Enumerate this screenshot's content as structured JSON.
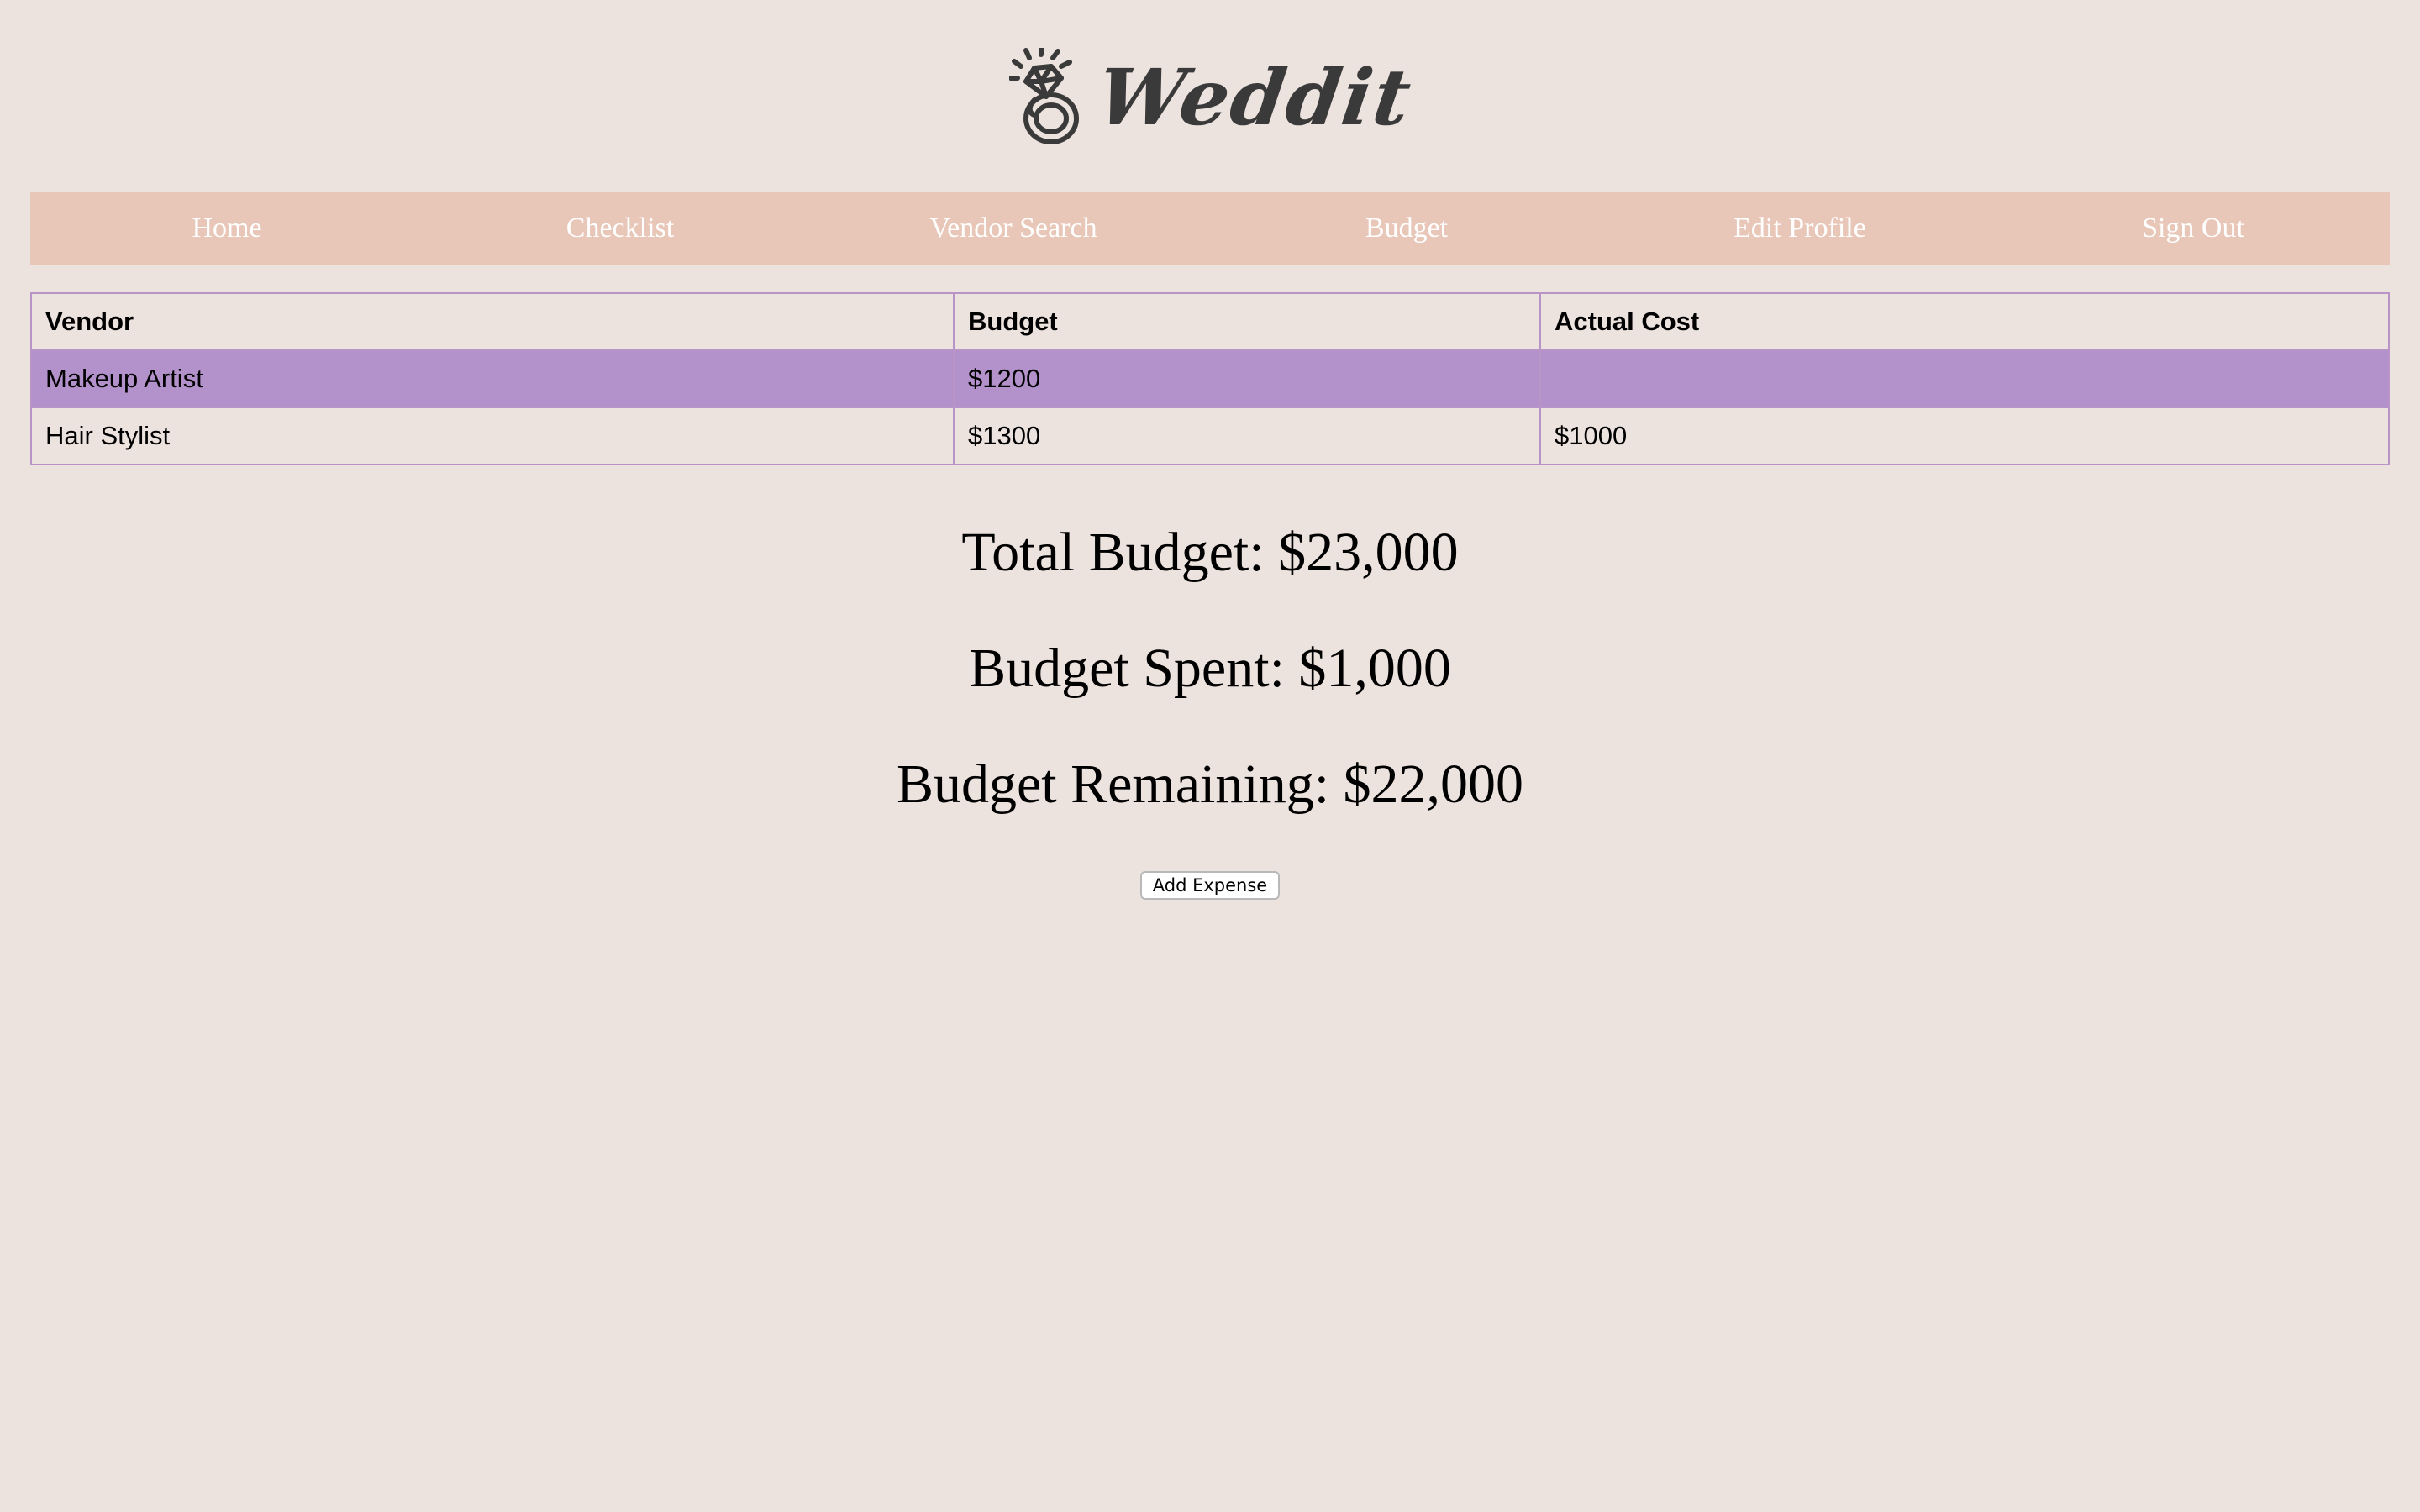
{
  "app": {
    "logo_text": "Weddit",
    "logo_icon": "diamond-ring-icon"
  },
  "nav": {
    "items": [
      "Home",
      "Checklist",
      "Vendor Search",
      "Budget",
      "Edit Profile",
      "Sign Out"
    ]
  },
  "table": {
    "headers": [
      "Vendor",
      "Budget",
      "Actual Cost"
    ],
    "rows": [
      {
        "vendor": "Makeup Artist",
        "budget": "$1200",
        "actual": ""
      },
      {
        "vendor": "Hair Stylist",
        "budget": "$1300",
        "actual": "$1000"
      }
    ],
    "highlight_color": "#b391cb",
    "border_color": "#b894c8"
  },
  "summary": {
    "total": "Total Budget: $23,000",
    "spent": "Budget Spent: $1,000",
    "remaining": "Budget Remaining: $22,000"
  },
  "actions": {
    "add_expense_label": "Add Expense"
  },
  "colors": {
    "background": "#ece2de",
    "nav_background": "#e8c7b8",
    "nav_text": "#ffffff"
  }
}
